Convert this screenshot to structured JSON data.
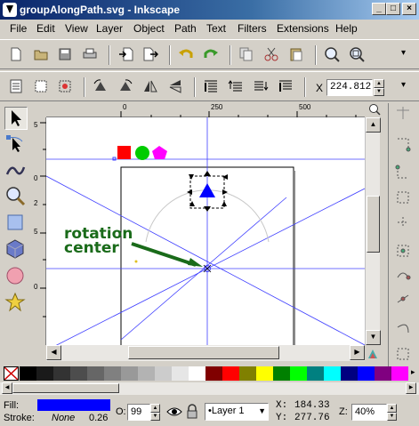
{
  "window": {
    "title": "groupAlongPath.svg - Inkscape"
  },
  "menu": {
    "items": [
      "File",
      "Edit",
      "View",
      "Layer",
      "Object",
      "Path",
      "Text",
      "Filters",
      "Extensions",
      "Help"
    ]
  },
  "command_bar": {
    "icons": [
      "new-document-icon",
      "open-icon",
      "save-icon",
      "print-icon",
      "import-icon",
      "export-icon",
      "undo-icon",
      "redo-icon",
      "copy-icon",
      "cut-icon",
      "paste-icon",
      "zoom-selection-icon",
      "zoom-drawing-icon"
    ]
  },
  "tool_controls": {
    "x_label": "X",
    "x_value": "224.812"
  },
  "ruler": {
    "h_ticks": [
      "0",
      "250",
      "500"
    ],
    "v_ticks": [
      "5",
      "0",
      "2",
      "5",
      "0"
    ]
  },
  "canvas": {
    "annotation_line1": "rotation",
    "annotation_line2": "center",
    "annotation_color": "#1a6b1a",
    "shape_colors": [
      "#ff0000",
      "#00cc00",
      "#ff00ff",
      "#0000ff"
    ]
  },
  "palette": {
    "colors": [
      "#000000",
      "#1a1a1a",
      "#333333",
      "#4d4d4d",
      "#666666",
      "#808080",
      "#999999",
      "#b3b3b3",
      "#cccccc",
      "#e6e6e6",
      "#ffffff",
      "#800000",
      "#ff0000",
      "#808000",
      "#ffff00",
      "#008000",
      "#00ff00",
      "#008080",
      "#00ffff",
      "#000080",
      "#0000ff",
      "#800080",
      "#ff00ff"
    ]
  },
  "status": {
    "fill_label": "Fill:",
    "fill_color": "#0000ff",
    "stroke_label": "Stroke:",
    "stroke_value": "None",
    "stroke_width": "0.26",
    "opacity_label": "O:",
    "opacity_value": "99",
    "layer_value": "•Layer 1",
    "x_label": "X:",
    "x_value": "184.33",
    "y_label": "Y:",
    "y_value": "277.76",
    "zoom_label": "Z:",
    "zoom_value": "40%"
  }
}
